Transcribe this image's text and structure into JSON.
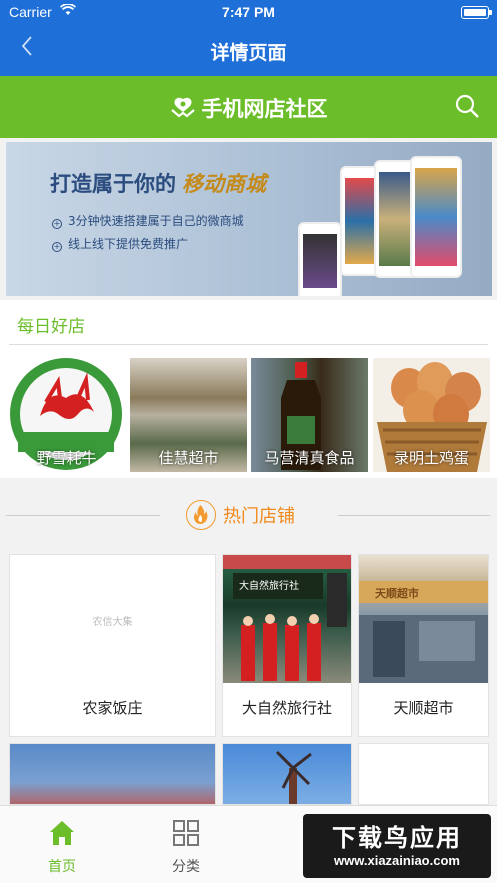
{
  "status_bar": {
    "carrier": "Carrier",
    "time": "7:47 PM"
  },
  "nav": {
    "title": "详情页面"
  },
  "brand_bar": {
    "title": "手机网店社区"
  },
  "banner": {
    "headline": "打造属于你的",
    "headline_highlight": "移动商城",
    "line1": "3分钟快速搭建属于自己的微商城",
    "line2": "线上线下提供免费推广"
  },
  "daily": {
    "label": "每日好店",
    "shops": [
      {
        "name": "野雪耗牛"
      },
      {
        "name": "佳慧超市"
      },
      {
        "name": "马营清真食品"
      },
      {
        "name": "录明土鸡蛋"
      }
    ]
  },
  "hot": {
    "label": "热门店铺",
    "placeholder_logo": "农信大集",
    "shop_sign": "大自然旅行社",
    "market_sign": "天顺超市",
    "cards": [
      {
        "name": "农家饭庄"
      },
      {
        "name": "大自然旅行社"
      },
      {
        "name": "天顺超市"
      }
    ]
  },
  "tabs": [
    {
      "label": "首页",
      "active": true
    },
    {
      "label": "分类",
      "active": false
    }
  ],
  "watermark": {
    "big": "下载鸟应用",
    "small": "www.xiazainiao.com"
  },
  "colors": {
    "nav_blue": "#1e6fd8",
    "brand_green": "#6cbd2a",
    "hot_orange": "#f08a1c"
  }
}
